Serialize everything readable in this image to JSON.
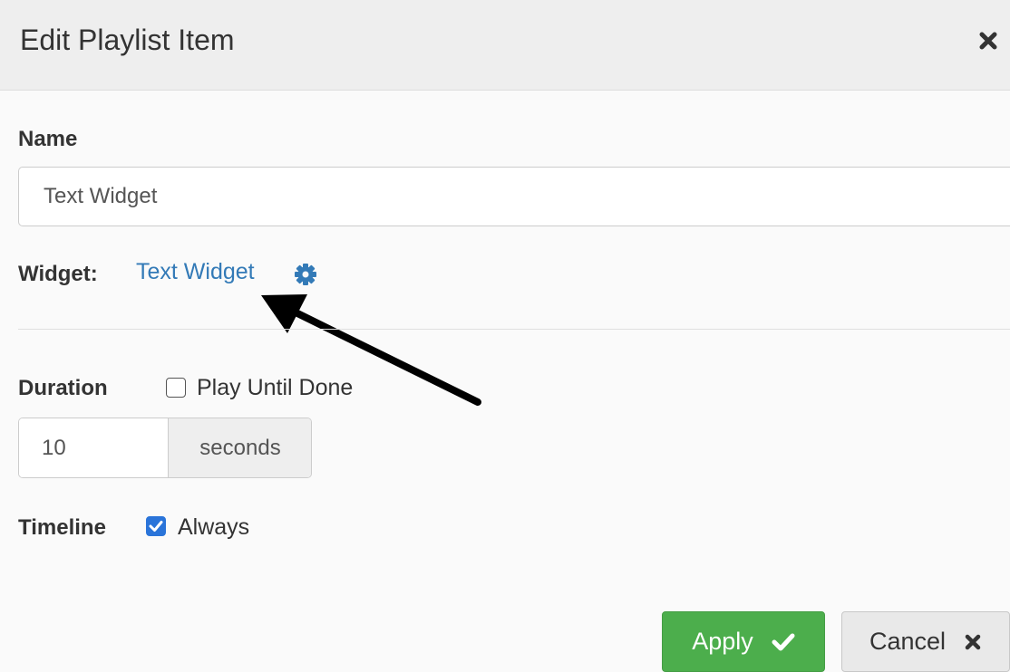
{
  "modal": {
    "title": "Edit Playlist Item",
    "close_icon": "close-icon"
  },
  "name_field": {
    "label": "Name",
    "value": "Text Widget"
  },
  "widget": {
    "label": "Widget:",
    "link_text": "Text Widget",
    "settings_icon": "gear-icon"
  },
  "duration": {
    "label": "Duration",
    "play_until_done": {
      "label": "Play Until Done",
      "checked": false
    },
    "value": "10",
    "unit": "seconds"
  },
  "timeline": {
    "label": "Timeline",
    "always": {
      "label": "Always",
      "checked": true
    }
  },
  "footer": {
    "apply_label": "Apply",
    "apply_icon": "checkmark-icon",
    "cancel_label": "Cancel",
    "cancel_icon": "close-icon"
  },
  "colors": {
    "link": "#337ab7",
    "primary_button": "#4cae4c",
    "checkbox_checked": "#2a74d9",
    "header_bg": "#eeeeee"
  }
}
